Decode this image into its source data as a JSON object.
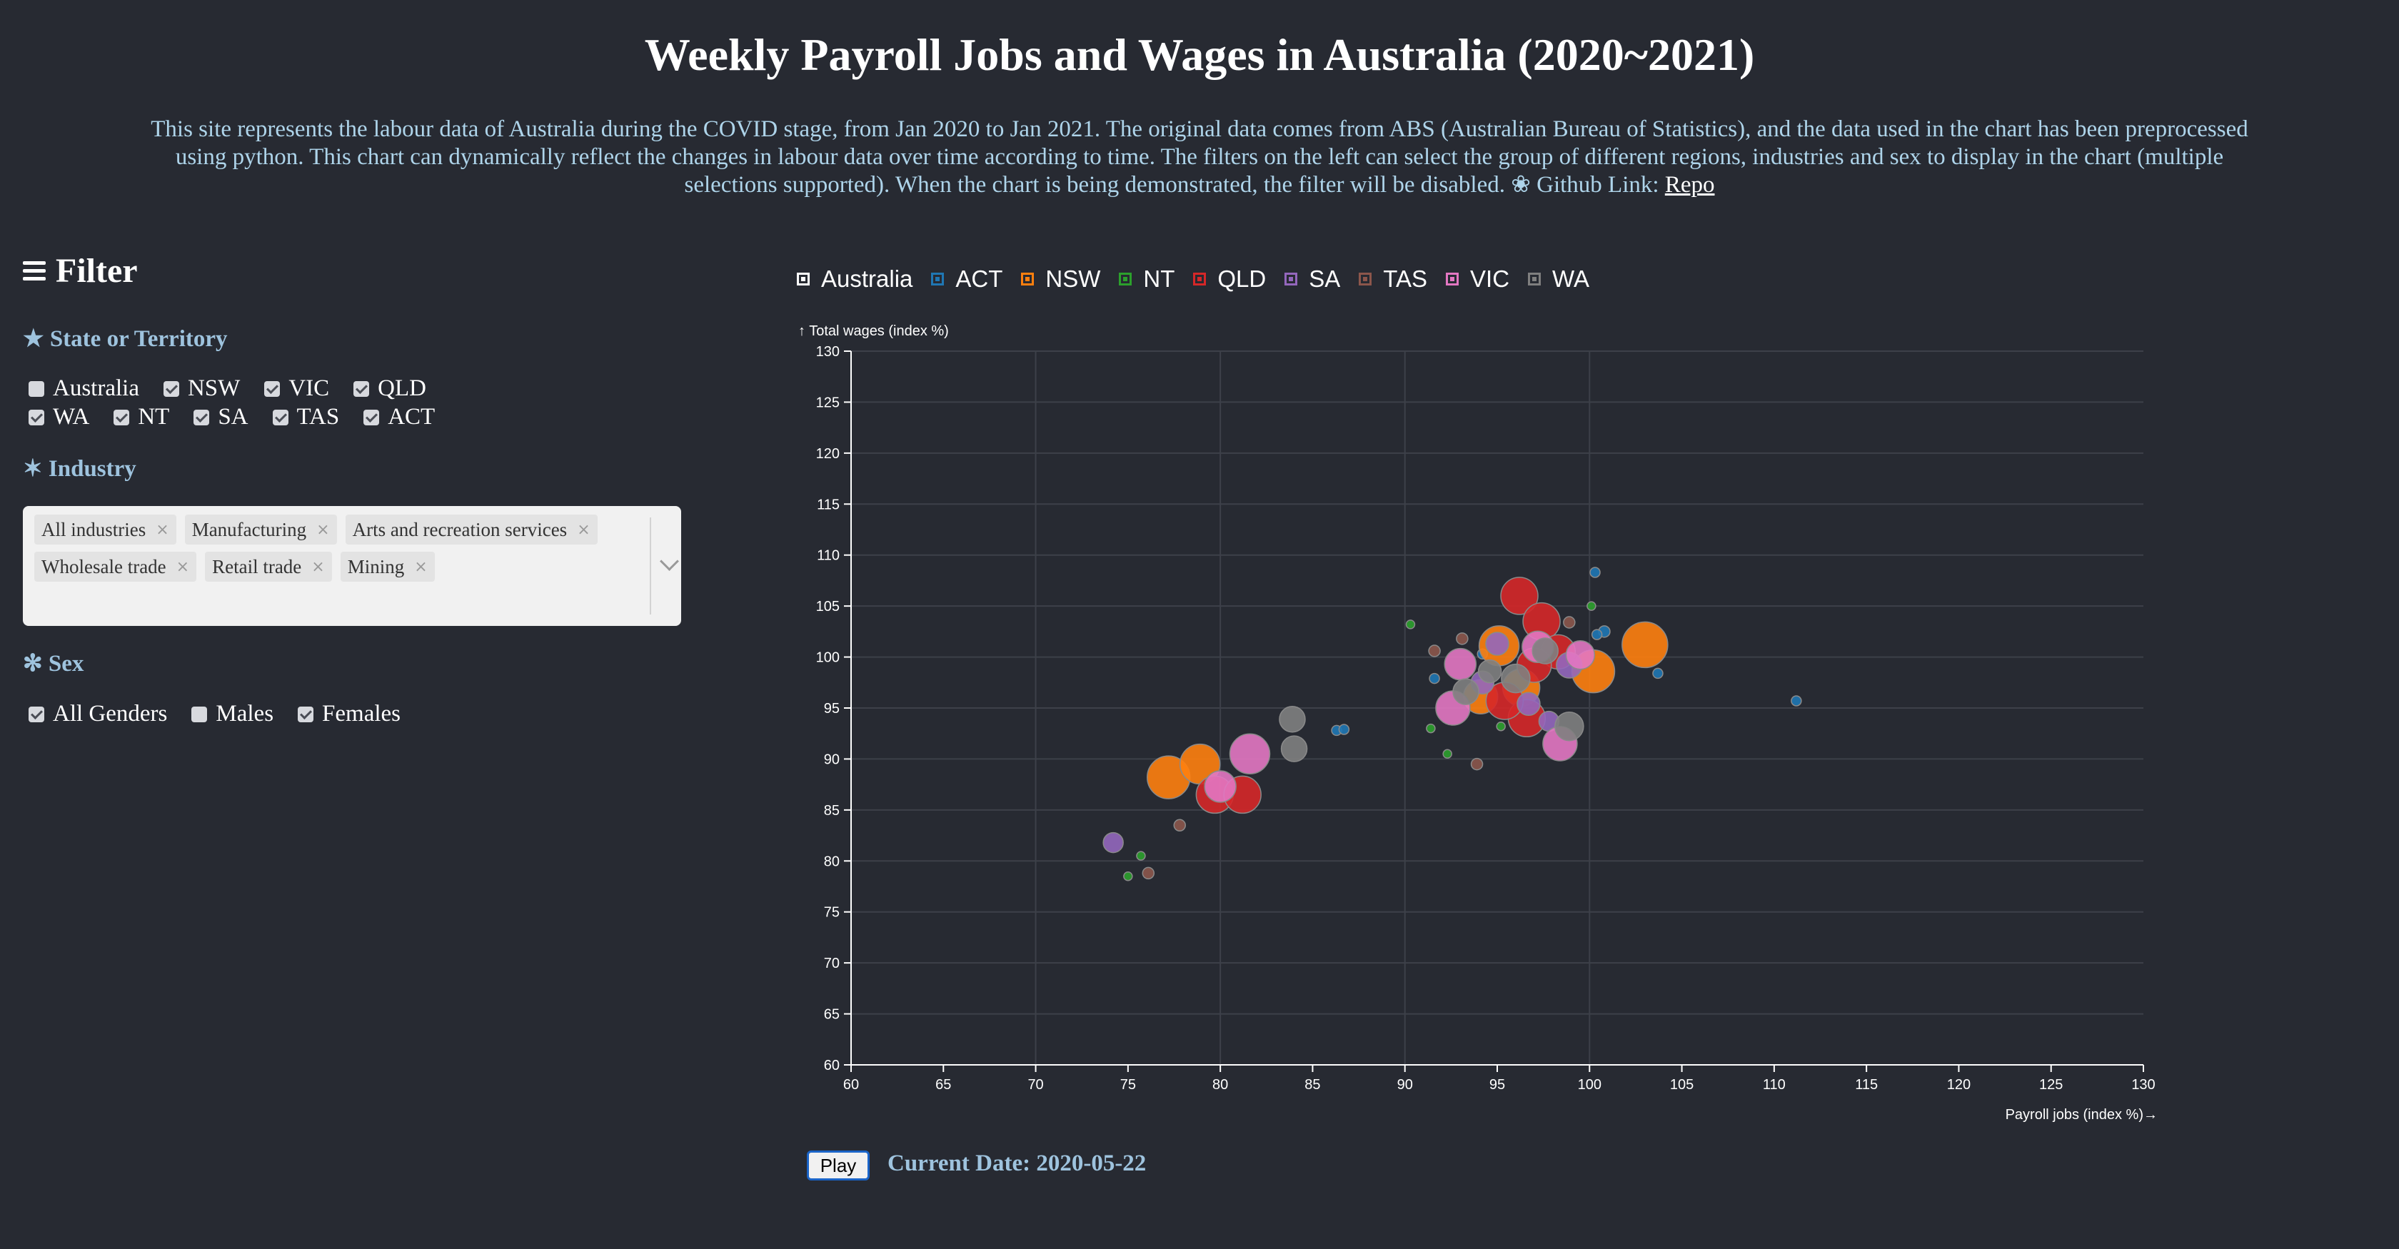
{
  "page": {
    "title": "Weekly Payroll Jobs and Wages in Australia (2020~2021)",
    "description": "This site represents the labour data of Australia during the COVID stage, from Jan 2020 to Jan 2021. The original data comes from ABS (Australian Bureau of Statistics), and the data used in the chart has been preprocessed using python. This chart can dynamically reflect the changes in labour data over time according to time. The filters on the left can select the group of different regions, industries and sex to display in the chart (multiple selections supported). When the chart is being demonstrated, the filter will be disabled. ❀ Github Link: ",
    "repo_link": "Repo"
  },
  "filter": {
    "title": "Filter",
    "state_title": "★ State or Territory",
    "states_row1": [
      {
        "label": "Australia",
        "checked": false
      },
      {
        "label": "NSW",
        "checked": true
      },
      {
        "label": "VIC",
        "checked": true
      },
      {
        "label": "QLD",
        "checked": true
      }
    ],
    "states_row2": [
      {
        "label": "WA",
        "checked": true
      },
      {
        "label": "NT",
        "checked": true
      },
      {
        "label": "SA",
        "checked": true
      },
      {
        "label": "TAS",
        "checked": true
      },
      {
        "label": "ACT",
        "checked": true
      }
    ],
    "industry_title": "✶ Industry",
    "industries": [
      "All industries",
      "Manufacturing",
      "Arts and recreation services",
      "Wholesale trade",
      "Retail trade",
      "Mining"
    ],
    "sex_title": "✻ Sex",
    "sexes": [
      {
        "label": "All Genders",
        "checked": true
      },
      {
        "label": "Males",
        "checked": false
      },
      {
        "label": "Females",
        "checked": true
      }
    ]
  },
  "controls": {
    "play_label": "Play",
    "current_date": "Current Date: 2020-05-22"
  },
  "chart_data": {
    "type": "scatter",
    "title": "",
    "xlabel": "Payroll jobs (index %)→",
    "ylabel": "↑ Total wages (index %)",
    "xlim": [
      60,
      130
    ],
    "ylim": [
      60,
      130
    ],
    "xticks": [
      60,
      65,
      70,
      75,
      80,
      85,
      90,
      95,
      100,
      105,
      110,
      115,
      120,
      125,
      130
    ],
    "yticks": [
      60,
      65,
      70,
      75,
      80,
      85,
      90,
      95,
      100,
      105,
      110,
      115,
      120,
      125,
      130
    ],
    "grid": true,
    "legend_position": "top",
    "legend": [
      {
        "name": "Australia",
        "color": "#ffffff"
      },
      {
        "name": "ACT",
        "color": "#1f77b4"
      },
      {
        "name": "NSW",
        "color": "#ff7f0e"
      },
      {
        "name": "NT",
        "color": "#2ca02c"
      },
      {
        "name": "QLD",
        "color": "#d62728"
      },
      {
        "name": "SA",
        "color": "#9467bd"
      },
      {
        "name": "TAS",
        "color": "#8c564b"
      },
      {
        "name": "VIC",
        "color": "#e377c2"
      },
      {
        "name": "WA",
        "color": "#7f7f7f"
      }
    ],
    "series": [
      {
        "name": "ACT",
        "color": "#1f77b4",
        "points": [
          {
            "x": 100.3,
            "y": 108.3,
            "r": 7
          },
          {
            "x": 111.2,
            "y": 95.7,
            "r": 7
          },
          {
            "x": 103.7,
            "y": 98.4,
            "r": 7
          },
          {
            "x": 86.3,
            "y": 92.8,
            "r": 7
          },
          {
            "x": 86.7,
            "y": 92.9,
            "r": 7
          },
          {
            "x": 100.8,
            "y": 102.5,
            "r": 8
          },
          {
            "x": 91.6,
            "y": 97.9,
            "r": 7
          },
          {
            "x": 94.2,
            "y": 100.3,
            "r": 7
          },
          {
            "x": 100.4,
            "y": 102.2,
            "r": 7
          }
        ]
      },
      {
        "name": "NSW",
        "color": "#ff7f0e",
        "points": [
          {
            "x": 77.2,
            "y": 88.2,
            "r": 30
          },
          {
            "x": 78.9,
            "y": 89.5,
            "r": 28
          },
          {
            "x": 103.0,
            "y": 101.2,
            "r": 32
          },
          {
            "x": 100.2,
            "y": 98.6,
            "r": 30
          },
          {
            "x": 95.1,
            "y": 101.1,
            "r": 28
          },
          {
            "x": 96.3,
            "y": 97.0,
            "r": 26
          },
          {
            "x": 94.1,
            "y": 96.1,
            "r": 24
          }
        ]
      },
      {
        "name": "NT",
        "color": "#2ca02c",
        "points": [
          {
            "x": 75.0,
            "y": 78.5,
            "r": 6
          },
          {
            "x": 75.7,
            "y": 80.5,
            "r": 6
          },
          {
            "x": 91.4,
            "y": 93.0,
            "r": 6
          },
          {
            "x": 92.3,
            "y": 90.5,
            "r": 6
          },
          {
            "x": 90.3,
            "y": 103.2,
            "r": 6
          },
          {
            "x": 100.1,
            "y": 105.0,
            "r": 6
          },
          {
            "x": 95.2,
            "y": 93.2,
            "r": 6
          }
        ]
      },
      {
        "name": "QLD",
        "color": "#d62728",
        "points": [
          {
            "x": 79.7,
            "y": 86.5,
            "r": 26
          },
          {
            "x": 81.2,
            "y": 86.5,
            "r": 26
          },
          {
            "x": 96.2,
            "y": 106.0,
            "r": 26
          },
          {
            "x": 97.4,
            "y": 103.5,
            "r": 26
          },
          {
            "x": 96.6,
            "y": 94.0,
            "r": 26
          },
          {
            "x": 95.4,
            "y": 95.7,
            "r": 26
          },
          {
            "x": 98.3,
            "y": 100.5,
            "r": 24
          },
          {
            "x": 97.0,
            "y": 99.2,
            "r": 24
          }
        ]
      },
      {
        "name": "SA",
        "color": "#9467bd",
        "points": [
          {
            "x": 74.2,
            "y": 81.8,
            "r": 14
          },
          {
            "x": 95.0,
            "y": 101.3,
            "r": 16
          },
          {
            "x": 98.9,
            "y": 99.2,
            "r": 18
          },
          {
            "x": 96.7,
            "y": 95.4,
            "r": 16
          },
          {
            "x": 94.2,
            "y": 97.5,
            "r": 16
          },
          {
            "x": 97.8,
            "y": 93.7,
            "r": 14
          }
        ]
      },
      {
        "name": "TAS",
        "color": "#8c564b",
        "points": [
          {
            "x": 76.1,
            "y": 78.8,
            "r": 8
          },
          {
            "x": 77.8,
            "y": 83.5,
            "r": 8
          },
          {
            "x": 93.9,
            "y": 89.5,
            "r": 8
          },
          {
            "x": 91.6,
            "y": 100.6,
            "r": 8
          },
          {
            "x": 93.1,
            "y": 101.8,
            "r": 8
          },
          {
            "x": 98.9,
            "y": 103.4,
            "r": 8
          }
        ]
      },
      {
        "name": "VIC",
        "color": "#e377c2",
        "points": [
          {
            "x": 80.0,
            "y": 87.3,
            "r": 22
          },
          {
            "x": 81.6,
            "y": 90.5,
            "r": 28
          },
          {
            "x": 92.6,
            "y": 95.0,
            "r": 24
          },
          {
            "x": 98.4,
            "y": 91.5,
            "r": 24
          },
          {
            "x": 93.0,
            "y": 99.3,
            "r": 22
          },
          {
            "x": 97.2,
            "y": 101.0,
            "r": 22
          },
          {
            "x": 99.5,
            "y": 100.2,
            "r": 20
          }
        ]
      },
      {
        "name": "WA",
        "color": "#7f7f7f",
        "points": [
          {
            "x": 83.9,
            "y": 93.9,
            "r": 18
          },
          {
            "x": 84.0,
            "y": 91.0,
            "r": 18
          },
          {
            "x": 98.9,
            "y": 93.2,
            "r": 20
          },
          {
            "x": 93.3,
            "y": 96.6,
            "r": 18
          },
          {
            "x": 97.6,
            "y": 100.6,
            "r": 18
          },
          {
            "x": 96.0,
            "y": 97.9,
            "r": 20
          },
          {
            "x": 94.6,
            "y": 98.6,
            "r": 16
          }
        ]
      }
    ]
  }
}
